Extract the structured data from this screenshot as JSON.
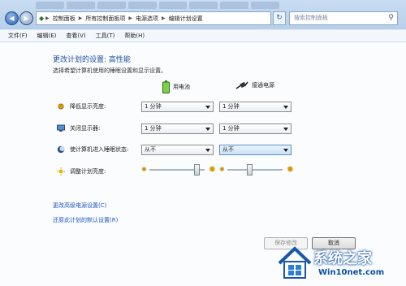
{
  "breadcrumb": [
    "控制面板",
    "所有控制面板项",
    "电源选项",
    "编辑计划设置"
  ],
  "search": {
    "placeholder": "搜索控制面板"
  },
  "menu": [
    "文件(F)",
    "编辑(E)",
    "查看(V)",
    "工具(T)",
    "帮助(H)"
  ],
  "page": {
    "title": "更改计划的设置: 高性能",
    "subtitle": "选择希望计算机使用的睡眠设置和显示设置。"
  },
  "columns": {
    "battery": "用电池",
    "plugged": "接通电源"
  },
  "rows": [
    {
      "label": "降低显示亮度:",
      "icon": "dim-display-icon",
      "battery": "1 分钟",
      "plugged": "1 分钟"
    },
    {
      "label": "关闭显示器:",
      "icon": "monitor-icon",
      "battery": "1 分钟",
      "plugged": "1 分钟"
    },
    {
      "label": "使计算机进入睡眠状态:",
      "icon": "sleep-moon-icon",
      "battery": "从不",
      "plugged": "从不"
    }
  ],
  "brightness": {
    "label": "调整计划亮度:",
    "battery_level": 0.85,
    "plugged_level": 0.4
  },
  "links": {
    "advanced": "更改高级电源设置(C)",
    "restore": "还原此计划的默认设置(R)"
  },
  "buttons": {
    "save": "保存修改",
    "cancel": "取消"
  },
  "watermark": {
    "brand": "系统之家",
    "site": "Win10net.com"
  },
  "colors": {
    "link": "#1f56c4",
    "heading": "#1f4e9c",
    "chrome": "#c9ddf2"
  }
}
